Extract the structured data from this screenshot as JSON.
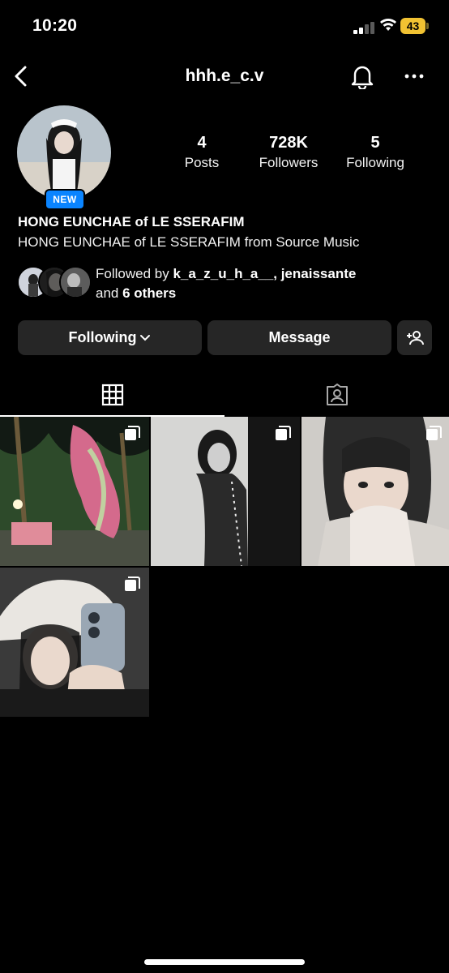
{
  "status_bar": {
    "time": "10:20",
    "battery": "43"
  },
  "header": {
    "username": "hhh.e_c.v"
  },
  "profile": {
    "new_badge": "NEW",
    "stats": [
      {
        "value": "4",
        "label": "Posts"
      },
      {
        "value": "728K",
        "label": "Followers"
      },
      {
        "value": "5",
        "label": "Following"
      }
    ],
    "display_name": "HONG EUNCHAE of LE SSERAFIM",
    "bio": "HONG EUNCHAE of LE SSERAFIM from Source Music",
    "followed_by": {
      "prefix": "Followed by",
      "names": "k_a_z_u_h_a__, jenaissante",
      "and": "and",
      "others": "6 others"
    }
  },
  "actions": {
    "following": "Following",
    "message": "Message"
  },
  "tabs": [
    {
      "name": "posts-grid",
      "active": true
    },
    {
      "name": "tagged",
      "active": false
    }
  ],
  "posts": [
    {
      "id": "post-1",
      "multi": true,
      "desc_colors": [
        "#1b2a1c",
        "#d46a8c"
      ]
    },
    {
      "id": "post-2",
      "multi": true,
      "desc_colors": [
        "#cfcfcf",
        "#111111"
      ]
    },
    {
      "id": "post-3",
      "multi": true,
      "desc_colors": [
        "#d9d4cf",
        "#2b2b2b"
      ]
    },
    {
      "id": "post-4",
      "multi": true,
      "desc_colors": [
        "#e4e2df",
        "#9aa7b4"
      ]
    }
  ],
  "colors": {
    "badge": "#0a84ff",
    "button_bg": "#262626",
    "battery": "#f1c232"
  }
}
